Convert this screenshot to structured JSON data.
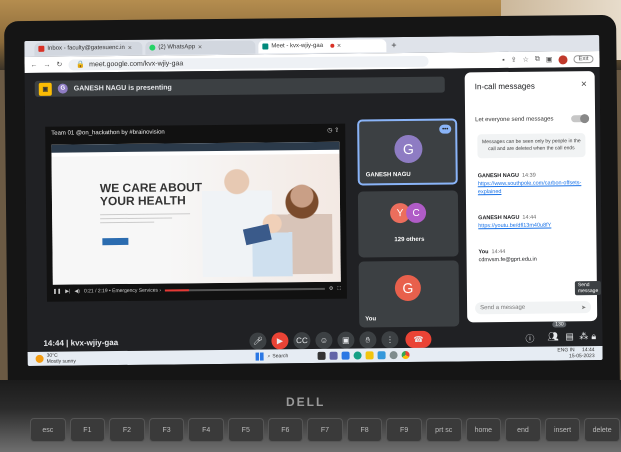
{
  "browser": {
    "tabs": [
      {
        "label": "Inbox - faculty@gatesuenc.in",
        "close": "×",
        "color": "#d93025"
      },
      {
        "label": "(2) WhatsApp",
        "close": "×",
        "color": "#25d366"
      },
      {
        "label": "Meet - kvx-wjiy-gaa",
        "close": "×",
        "color": "#00897b"
      }
    ],
    "new_tab": "+",
    "url": "meet.google.com/kvx-wjiy-gaa",
    "exit_label": "Exit"
  },
  "meet": {
    "presenter_initial": "G",
    "presenting_banner": "GANESH NAGU is presenting",
    "share_title": "Team 01 @on_hackathon by #brainovision",
    "hero_line1": "WE CARE ABOUT",
    "hero_line2": "YOUR HEALTH",
    "video_time": "0:21 / 2:19 • Emergency Services ›",
    "video_progress": 0.15,
    "tiles": [
      {
        "name": "GANESH NAGU",
        "initial": "G",
        "color": "#8e7cc3"
      },
      {
        "name": "129 others",
        "initials": [
          "Y",
          "C"
        ],
        "colors": [
          "#ec6e5d",
          "#b05cc7"
        ]
      },
      {
        "name": "You",
        "initial": "G",
        "color": "#e8604c"
      }
    ],
    "more_icon": "•••",
    "meeting_time": "14:44",
    "meeting_code": "kvx-wjiy-gaa",
    "participant_badge": "130"
  },
  "panel": {
    "title": "In-call messages",
    "close": "×",
    "toggle_label": "Let everyone send messages",
    "notice": "Messages can be seen only by people in the call and are deleted when the call ends",
    "messages": [
      {
        "sender": "GANESH NAGU",
        "time": "14:39",
        "body": "https://www.southpole.com/carbon-offsets-explained",
        "is_link": true
      },
      {
        "sender": "GANESH NAGU",
        "time": "14:44",
        "body": "https://youtu.be/dfl13m40u8fY",
        "is_link": true
      },
      {
        "sender": "You",
        "time": "14:44",
        "body": "cdmvsm.fe@gprt.edu.in",
        "is_link": false
      }
    ],
    "tooltip": "Send message",
    "send_placeholder": "Send a message",
    "send_icon": "➤"
  },
  "taskbar": {
    "temperature": "30°C",
    "weather": "Mostly sunny",
    "search_label": "Search",
    "lang": "ENG",
    "lang_region": "IN",
    "clock_time": "14:44",
    "clock_date": "15-05-2023"
  },
  "laptop": {
    "brand": "DELL"
  }
}
